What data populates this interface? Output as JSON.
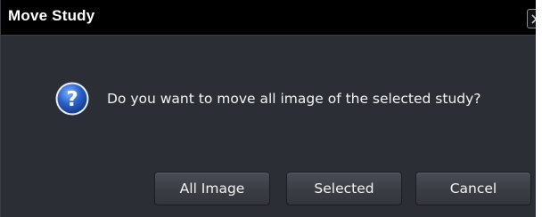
{
  "dialog": {
    "title": "Move Study",
    "close_icon": "close-icon",
    "message": "Do you want to move all image of the selected study?",
    "message_icon": "question-icon",
    "buttons": {
      "all_image": "All Image",
      "selected": "Selected",
      "cancel": "Cancel"
    }
  },
  "colors": {
    "titlebar": "#000000",
    "body": "#2b2e35",
    "icon_blue": "#2a62c9",
    "button": "#3a3d44",
    "text": "#f2f2f2"
  }
}
